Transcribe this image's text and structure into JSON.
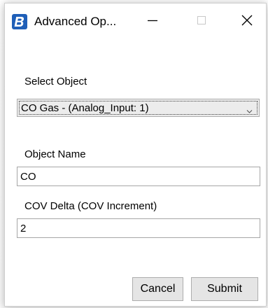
{
  "window": {
    "title": "Advanced Op...",
    "app_icon": "b-logo-icon",
    "controls": {
      "minimize_icon": "minimize-icon",
      "maximize_icon": "maximize-icon",
      "close_icon": "close-icon"
    }
  },
  "form": {
    "select_object": {
      "label": "Select Object",
      "selected_value": "CO Gas - (Analog_Input: 1)",
      "arrow_icon": "chevron-down-icon"
    },
    "object_name": {
      "label": "Object Name",
      "value": "CO"
    },
    "cov_delta": {
      "label": "COV Delta (COV Increment)",
      "value": "2"
    }
  },
  "actions": {
    "cancel_label": "Cancel",
    "submit_label": "Submit"
  },
  "colors": {
    "app_icon_blue": "#1f5fb8",
    "combo_background": "#ececec",
    "button_background": "#e5e5e5",
    "border": "#a6a6a6"
  }
}
